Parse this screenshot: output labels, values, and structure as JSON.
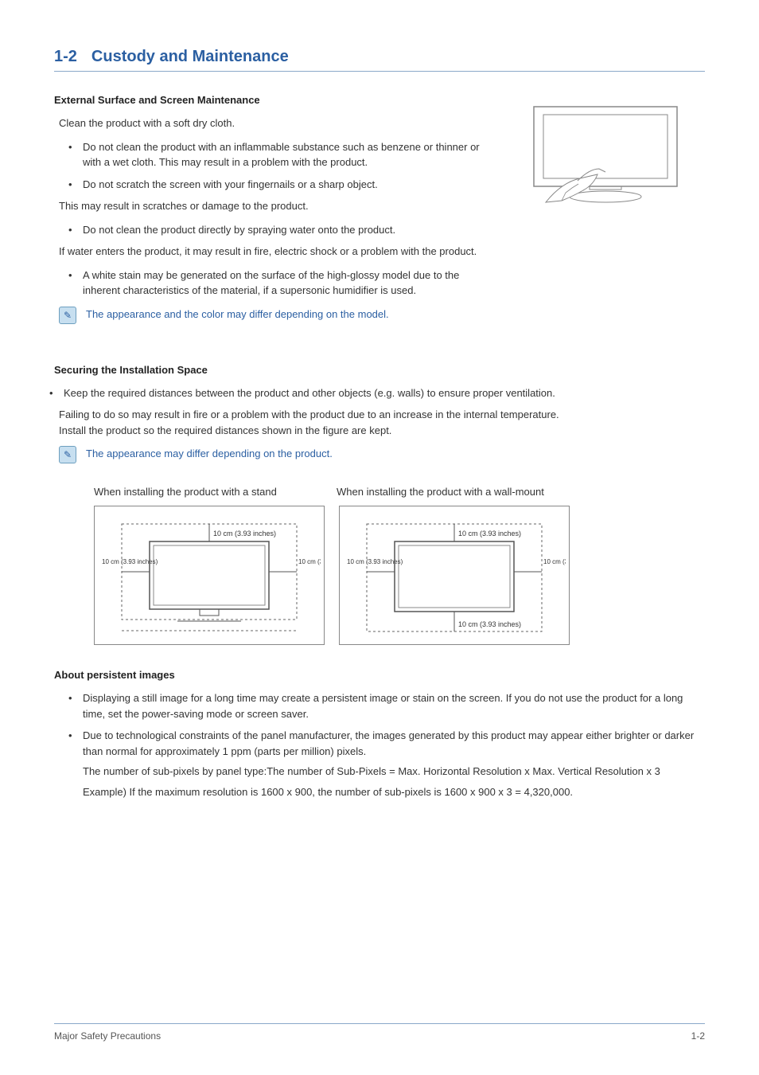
{
  "title": {
    "number": "1-2",
    "text": "Custody and Maintenance"
  },
  "s1": {
    "heading": "External Surface and Screen Maintenance",
    "intro": "Clean the product with a soft dry cloth.",
    "b1": "Do not clean the product with an inflammable substance such as benzene or thinner or with a wet cloth. This may result in a problem with the product.",
    "b2": "Do not scratch the screen with your fingernails or a sharp object.",
    "after2": "This may result in scratches or damage to the product.",
    "b3": "Do not clean the product directly by spraying water onto the product.",
    "after3": "If water enters the product, it may result in fire, electric shock or a problem with the product.",
    "b4": "A white stain may be generated on the surface of the high-glossy model due to the inherent characteristics of the material, if a supersonic humidifier is used.",
    "note": "The appearance and the color may differ depending on the model."
  },
  "s2": {
    "heading": "Securing the Installation Space",
    "b1": "Keep the required distances between the product and other objects (e.g. walls) to ensure proper ventilation.",
    "after1": "Failing to do so may result in fire or a problem with the product due to an increase in the internal temperature.\nInstall the product so the required distances shown in the figure are kept.",
    "note": "The appearance may differ depending on the product.",
    "cap1": "When installing the product with a stand",
    "cap2": "When installing the product with a wall-mount",
    "measTop": "10 cm (3.93 inches)",
    "measSide": "10 cm\n(3.93\ninches)",
    "measBottom": "10 cm (3.93 inches)"
  },
  "s3": {
    "heading": "About persistent images",
    "b1": "Displaying a still image for a long time may create a persistent image or stain on the screen. If you do not use the product for a long time, set the power-saving mode or screen saver.",
    "b2": "Due to technological constraints of the panel manufacturer, the images generated by this product may appear either brighter or darker than normal for approximately 1 ppm (parts per million) pixels.",
    "b2a": "The number of sub-pixels by panel type:The number of Sub-Pixels = Max. Horizontal Resolution x Max. Vertical Resolution x 3",
    "b2b": "Example) If the maximum resolution is 1600 x 900, the number of sub-pixels is 1600 x 900 x 3 = 4,320,000."
  },
  "footer": {
    "left": "Major Safety Precautions",
    "right": "1-2"
  }
}
